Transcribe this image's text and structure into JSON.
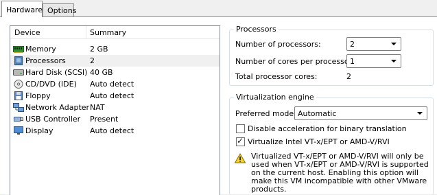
{
  "tabs": [
    {
      "label": "Hardware"
    },
    {
      "label": "Options"
    }
  ],
  "devices": {
    "header": {
      "device": "Device",
      "summary": "Summary"
    },
    "rows": [
      {
        "name": "Memory",
        "summary": "2 GB",
        "icon": "memory-icon"
      },
      {
        "name": "Processors",
        "summary": "2",
        "icon": "processor-icon"
      },
      {
        "name": "Hard Disk (SCSI)",
        "summary": "40 GB",
        "icon": "hard-disk-icon"
      },
      {
        "name": "CD/DVD (IDE)",
        "summary": "Auto detect",
        "icon": "cd-dvd-icon"
      },
      {
        "name": "Floppy",
        "summary": "Auto detect",
        "icon": "floppy-icon"
      },
      {
        "name": "Network Adapter",
        "summary": "NAT",
        "icon": "network-adapter-icon"
      },
      {
        "name": "USB Controller",
        "summary": "Present",
        "icon": "usb-icon"
      },
      {
        "name": "Display",
        "summary": "Auto detect",
        "icon": "display-icon"
      }
    ]
  },
  "processors": {
    "title": "Processors",
    "num_processors_label": "Number of processors:",
    "num_processors_value": "2",
    "cores_label": "Number of cores per processor:",
    "cores_value": "1",
    "total_label": "Total processor cores:",
    "total_value": "2"
  },
  "virtualization": {
    "title": "Virtualization engine",
    "mode_label": "Preferred mode:",
    "mode_value": "Automatic",
    "disable_accel_label": "Disable acceleration for binary translation",
    "disable_accel_checked": false,
    "vtx_label": "Virtualize Intel VT-x/EPT or AMD-V/RVI",
    "vtx_checked": true,
    "warning_text": "Virtualized VT-x/EPT or AMD-V/RVI will only be used when VT-x/EPT or AMD-V/RVI is supported on the current host. Enabling this option will make this VM incompatible with other VMware products.",
    "warning_icon": "warning-icon"
  },
  "colors": {
    "selected_row": "#f0f0f0",
    "warning_yellow": "#f5d327"
  }
}
